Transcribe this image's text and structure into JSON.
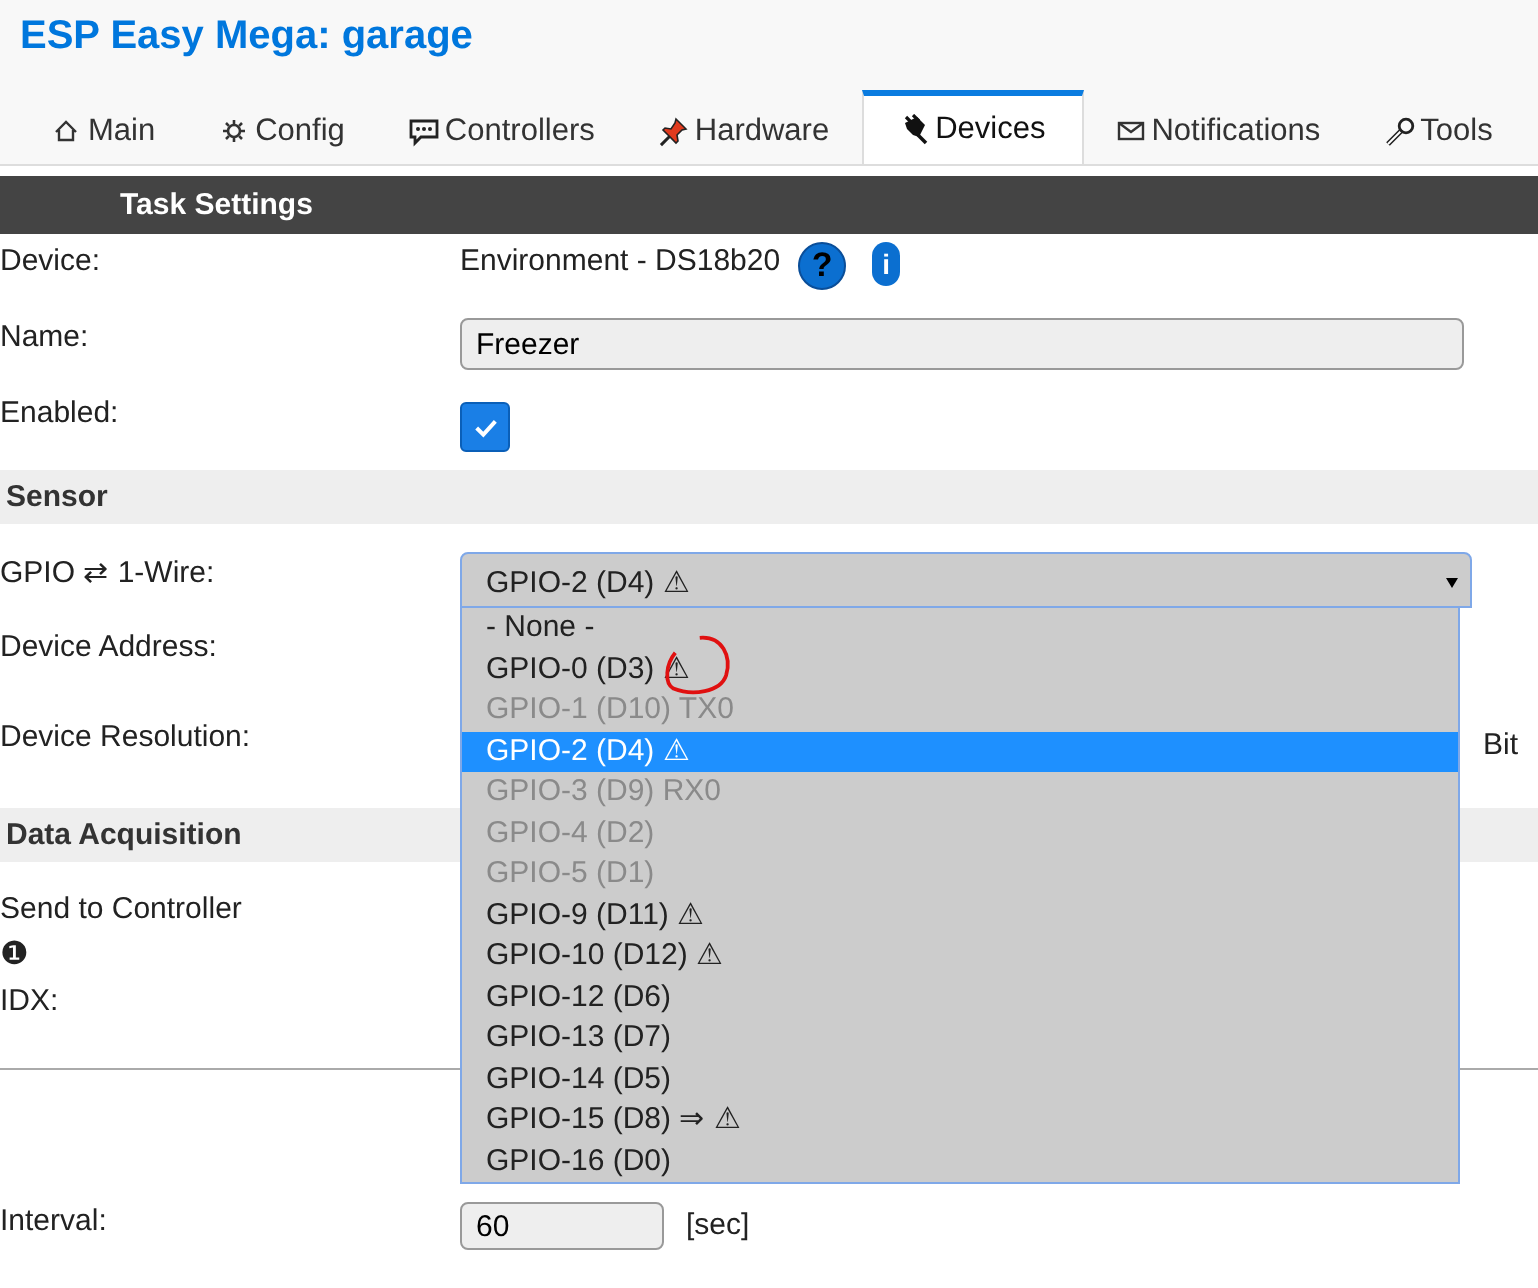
{
  "header": {
    "title": "ESP Easy Mega: garage"
  },
  "tabs": [
    {
      "label": "Main",
      "selected": false
    },
    {
      "label": "Config",
      "selected": false
    },
    {
      "label": "Controllers",
      "selected": false
    },
    {
      "label": "Hardware",
      "selected": false
    },
    {
      "label": "Devices",
      "selected": true
    },
    {
      "label": "Notifications",
      "selected": false
    },
    {
      "label": "Tools",
      "selected": false
    }
  ],
  "panel_title": "Task Settings",
  "rows": [
    {
      "kind": "text",
      "label": "Device:",
      "value": "Environment - DS18b20",
      "help": "?",
      "info": "i"
    },
    {
      "kind": "input",
      "label": "Name:",
      "value": "Freezer"
    },
    {
      "kind": "checkbox",
      "label": "Enabled:",
      "checked": true
    },
    {
      "kind": "section",
      "label": "Sensor"
    },
    {
      "kind": "select",
      "label": "GPIO ⇄ 1-Wire:",
      "value": "GPIO-2 (D4) ⚠",
      "expanded": true,
      "options": [
        {
          "label": "- None -",
          "disabled": false,
          "selected": false,
          "annotated": false
        },
        {
          "label": "GPIO-0 (D3) ⚠",
          "disabled": false,
          "selected": false,
          "annotated": true
        },
        {
          "label": "GPIO-1 (D10) TX0",
          "disabled": true,
          "selected": false,
          "annotated": false
        },
        {
          "label": "GPIO-2 (D4) ⚠",
          "disabled": false,
          "selected": true,
          "annotated": false
        },
        {
          "label": "GPIO-3 (D9) RX0",
          "disabled": true,
          "selected": false,
          "annotated": false
        },
        {
          "label": "GPIO-4 (D2)",
          "disabled": true,
          "selected": false,
          "annotated": false
        },
        {
          "label": "GPIO-5 (D1)",
          "disabled": true,
          "selected": false,
          "annotated": false
        },
        {
          "label": "GPIO-9 (D11) ⚠",
          "disabled": false,
          "selected": false,
          "annotated": false
        },
        {
          "label": "GPIO-10 (D12) ⚠",
          "disabled": false,
          "selected": false,
          "annotated": false
        },
        {
          "label": "GPIO-12 (D6)",
          "disabled": false,
          "selected": false,
          "annotated": false
        },
        {
          "label": "GPIO-13 (D7)",
          "disabled": false,
          "selected": false,
          "annotated": false
        },
        {
          "label": "GPIO-14 (D5)",
          "disabled": false,
          "selected": false,
          "annotated": false
        },
        {
          "label": "GPIO-15 (D8) ⇒ ⚠",
          "disabled": false,
          "selected": false,
          "annotated": false
        },
        {
          "label": "GPIO-16 (D0)",
          "disabled": false,
          "selected": false,
          "annotated": false
        }
      ]
    },
    {
      "kind": "hidden",
      "label": "Device Address:"
    },
    {
      "kind": "hidden",
      "label": "Device Resolution:",
      "unit": "Bit"
    },
    {
      "kind": "section",
      "label": "Data Acquisition"
    },
    {
      "kind": "hidden",
      "label": "Send to Controller",
      "note": "❶"
    },
    {
      "kind": "hidden",
      "label": "IDX:"
    },
    {
      "kind": "rule"
    },
    {
      "kind": "small_input",
      "label": "Interval:",
      "value": "60",
      "unit": "[sec]"
    }
  ]
}
